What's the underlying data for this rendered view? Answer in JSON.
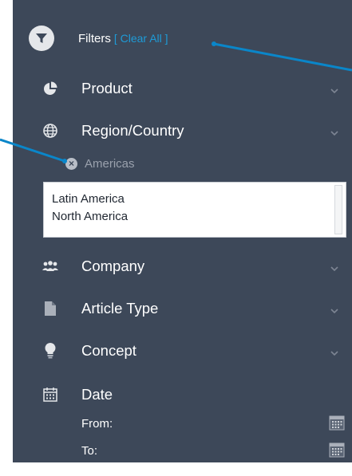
{
  "header": {
    "title": "Filters",
    "clear_all": "[ Clear All ]"
  },
  "sections": [
    {
      "label": "Product",
      "icon": "pie-chart-icon"
    },
    {
      "label": "Region/Country",
      "icon": "globe-icon"
    },
    {
      "label": "Company",
      "icon": "users-icon"
    },
    {
      "label": "Article Type",
      "icon": "document-icon"
    },
    {
      "label": "Concept",
      "icon": "lightbulb-icon"
    },
    {
      "label": "Date",
      "icon": "calendar-icon"
    }
  ],
  "region_filter": {
    "selected_tag": "Americas",
    "options": [
      "Latin America",
      "North America"
    ]
  },
  "date": {
    "from_label": "From:",
    "to_label": "To:"
  },
  "colors": {
    "panel": "#3d4859",
    "accent": "#1e9bd7",
    "callout": "#0a86c9"
  }
}
